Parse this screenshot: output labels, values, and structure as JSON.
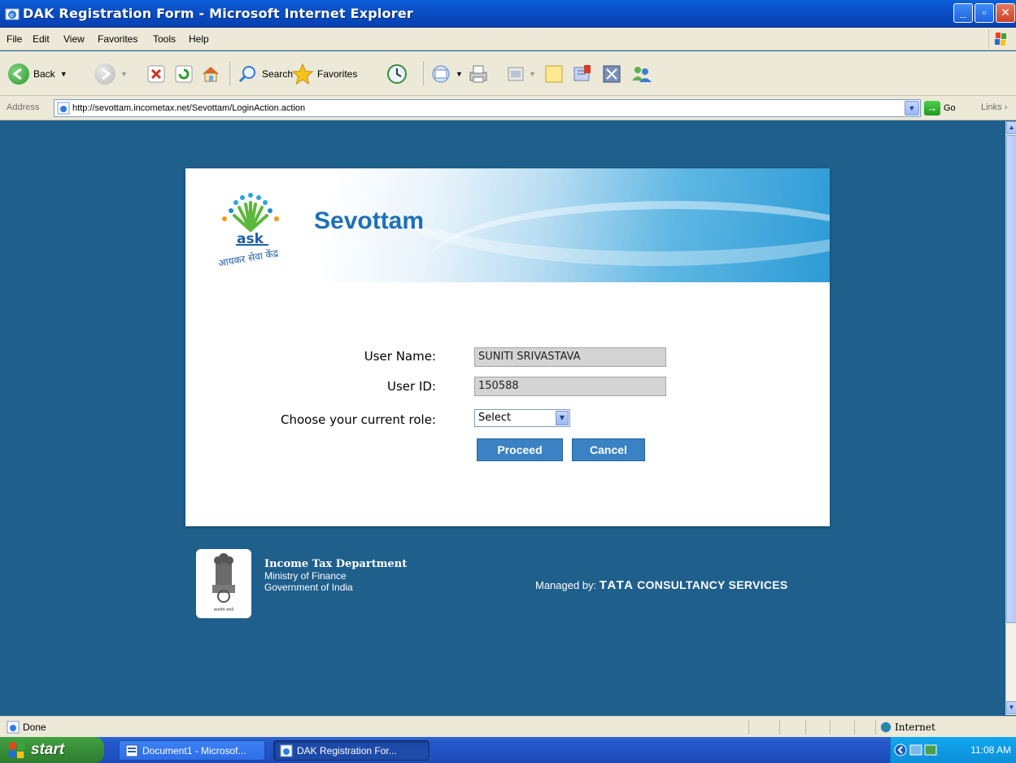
{
  "window": {
    "title": "DAK Registration Form - Microsoft Internet Explorer"
  },
  "menu": [
    "File",
    "Edit",
    "View",
    "Favorites",
    "Tools",
    "Help"
  ],
  "toolbar": {
    "back_label": "Back",
    "search_label": "Search",
    "favorites_label": "Favorites"
  },
  "address": {
    "label": "Address",
    "url": "http://sevottam.incometax.net/Sevottam/LoginAction.action",
    "go_label": "Go",
    "links_label": "Links"
  },
  "page": {
    "brand": "Sevottam",
    "logo_text": "ask",
    "logo_tagline": "आयकर सेवा केंद्र",
    "form": {
      "username_label": "User Name:",
      "username_value": "SUNITI SRIVASTAVA",
      "userid_label": "User ID:",
      "userid_value": "150588",
      "role_label": "Choose your current role:",
      "role_selected": "Select",
      "proceed_label": "Proceed",
      "cancel_label": "Cancel"
    },
    "footer": {
      "dept": "Income Tax Department",
      "ministry": "Ministry of Finance",
      "gov": "Government of India",
      "emblem_text": "सत्यमेव जयते",
      "managed_prefix": "Managed by:",
      "managed_tata": "TATA",
      "managed_cs": "CONSULTANCY SERVICES"
    }
  },
  "status": {
    "text": "Done",
    "zone": "Internet"
  },
  "taskbar": {
    "start_label": "start",
    "tasks": [
      {
        "label": "Document1 - Microsof..."
      },
      {
        "label": "DAK Registration For..."
      }
    ],
    "clock": "11:08 AM"
  },
  "colors": {
    "page_bg": "#1f5f8c",
    "brand_blue": "#1f6fba",
    "button_blue": "#3a82c4"
  }
}
